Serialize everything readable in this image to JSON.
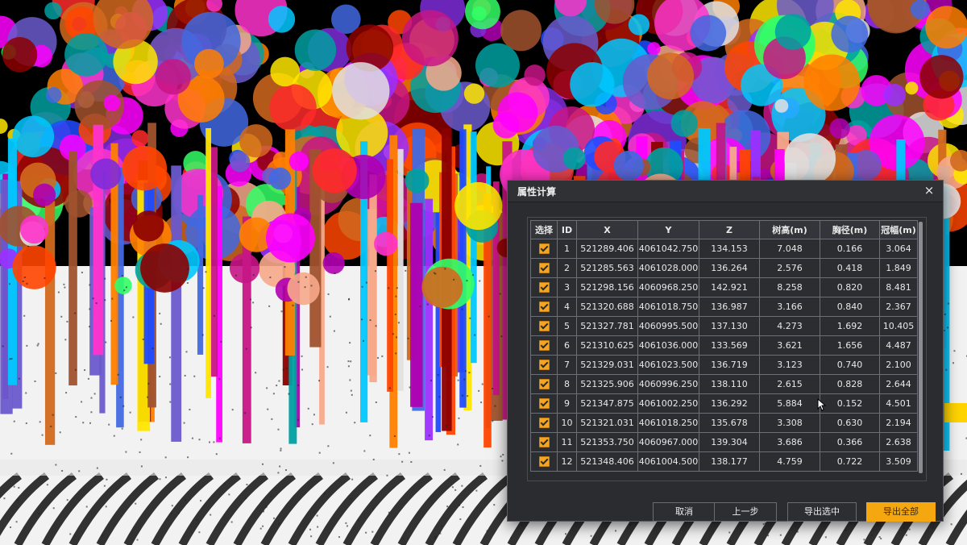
{
  "dialog": {
    "title": "属性计算",
    "close_symbol": "×"
  },
  "table": {
    "headers": [
      "选择",
      "ID",
      "X",
      "Y",
      "Z",
      "树高(m)",
      "胸径(m)",
      "冠幅(m)"
    ],
    "rows": [
      {
        "checked": true,
        "id": "1",
        "x": "521289.406",
        "y": "4061042.750",
        "z": "134.153",
        "height": "7.048",
        "dbh": "0.166",
        "crown": "3.064"
      },
      {
        "checked": true,
        "id": "2",
        "x": "521285.563",
        "y": "4061028.000",
        "z": "136.264",
        "height": "2.576",
        "dbh": "0.418",
        "crown": "1.849"
      },
      {
        "checked": true,
        "id": "3",
        "x": "521298.156",
        "y": "4060968.250",
        "z": "142.921",
        "height": "8.258",
        "dbh": "0.820",
        "crown": "8.481"
      },
      {
        "checked": true,
        "id": "4",
        "x": "521320.688",
        "y": "4061018.750",
        "z": "136.987",
        "height": "3.166",
        "dbh": "0.840",
        "crown": "2.367"
      },
      {
        "checked": true,
        "id": "5",
        "x": "521327.781",
        "y": "4060995.500",
        "z": "137.130",
        "height": "4.273",
        "dbh": "1.692",
        "crown": "10.405"
      },
      {
        "checked": true,
        "id": "6",
        "x": "521310.625",
        "y": "4061036.000",
        "z": "133.569",
        "height": "3.621",
        "dbh": "1.656",
        "crown": "4.487"
      },
      {
        "checked": true,
        "id": "7",
        "x": "521329.031",
        "y": "4061023.500",
        "z": "136.719",
        "height": "3.123",
        "dbh": "0.740",
        "crown": "2.100"
      },
      {
        "checked": true,
        "id": "8",
        "x": "521325.906",
        "y": "4060996.250",
        "z": "138.110",
        "height": "2.615",
        "dbh": "0.828",
        "crown": "2.644"
      },
      {
        "checked": true,
        "id": "9",
        "x": "521347.875",
        "y": "4061002.250",
        "z": "136.292",
        "height": "5.884",
        "dbh": "0.152",
        "crown": "4.501"
      },
      {
        "checked": true,
        "id": "10",
        "x": "521321.031",
        "y": "4061018.250",
        "z": "135.678",
        "height": "3.308",
        "dbh": "0.630",
        "crown": "2.194"
      },
      {
        "checked": true,
        "id": "11",
        "x": "521353.750",
        "y": "4060967.000",
        "z": "139.304",
        "height": "3.686",
        "dbh": "0.366",
        "crown": "2.638"
      },
      {
        "checked": true,
        "id": "12",
        "x": "521348.406",
        "y": "4061004.500",
        "z": "138.177",
        "height": "4.759",
        "dbh": "0.722",
        "crown": "3.509"
      }
    ]
  },
  "buttons": {
    "cancel": "取消",
    "prev": "上一步",
    "export_selected": "导出选中",
    "export_all": "导出全部"
  },
  "colors": {
    "accent": "#f5a70f",
    "dialog_bg": "#2b2c2f"
  },
  "icons": {
    "close": "close-icon",
    "checkbox": "checkbox-checked-icon",
    "cursor": "mouse-cursor-icon"
  }
}
